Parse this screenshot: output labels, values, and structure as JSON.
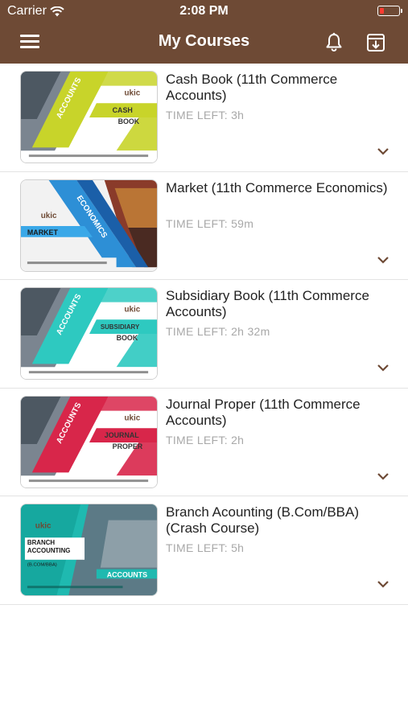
{
  "status_bar": {
    "carrier": "Carrier",
    "time": "2:08 PM",
    "battery_level": 0.15
  },
  "header": {
    "title": "My Courses",
    "icons": [
      "menu-icon",
      "bell-icon",
      "archive-download-icon"
    ]
  },
  "colors": {
    "header_bg": "#6e4a35",
    "time_left_text": "#a8a8a8",
    "chevron": "#6e4a35"
  },
  "courses": [
    {
      "title": "Cash Book (11th Commerce Accounts)",
      "time_left": "TIME LEFT: 3h",
      "thumb": {
        "accent": "#c8d42a",
        "subject": "ACCOUNTS",
        "topic_line1": "CASH",
        "topic_line2": "BOOK",
        "brand": "ukic"
      }
    },
    {
      "title": "Market (11th Commerce Economics)",
      "time_left": "TIME LEFT: 59m",
      "thumb": {
        "accent": "#2d8fd6",
        "subject": "ECONOMICS",
        "topic_line1": "MARKET",
        "topic_line2": "",
        "brand": "ukic"
      }
    },
    {
      "title": "Subsidiary Book (11th Commerce Accounts)",
      "time_left": "TIME LEFT: 2h 32m",
      "thumb": {
        "accent": "#2ec9c0",
        "subject": "ACCOUNTS",
        "topic_line1": "SUBSIDIARY",
        "topic_line2": "BOOK",
        "brand": "ukic"
      }
    },
    {
      "title": "Journal Proper (11th Commerce Accounts)",
      "time_left": "TIME LEFT: 2h",
      "thumb": {
        "accent": "#d8264a",
        "subject": "ACCOUNTS",
        "topic_line1": "JOURNAL",
        "topic_line2": "PROPER",
        "brand": "ukic"
      }
    },
    {
      "title": "Branch Acounting (B.Com/BBA) (Crash Course)",
      "time_left": "TIME LEFT: 5h",
      "thumb": {
        "accent": "#1fb9b0",
        "subject": "ACCOUNTS",
        "topic_line1": "BRANCH",
        "topic_line2": "ACCOUNTING",
        "topic_line3": "(B.COM/BBA)",
        "brand": "ukic"
      }
    }
  ]
}
